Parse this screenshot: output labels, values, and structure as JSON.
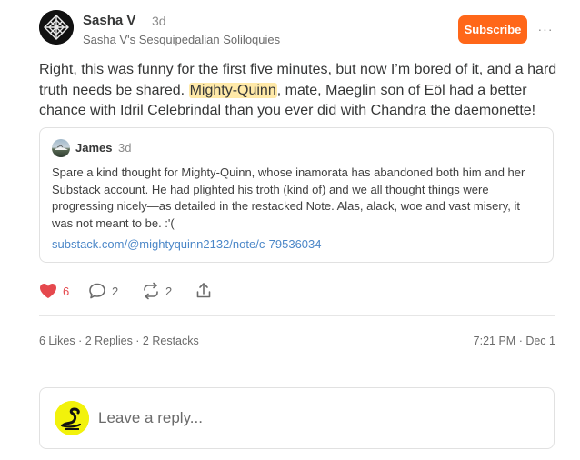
{
  "author": {
    "name": "Sasha V",
    "time": "3d",
    "publication": "Sasha V's Sesquipedalian Soliloquies"
  },
  "header": {
    "subscribe_label": "Subscribe",
    "more_label": "···"
  },
  "note": {
    "text_before": "Right, this was funny for the first five minutes, but now I’m bored of it, and a hard truth needs be shared. ",
    "mention": "Mighty-Quinn",
    "text_after": ", mate, Maeglin son of Eöl had a better chance with Idril Celebrindal than you ever did with Chandra the daemonette!"
  },
  "quote": {
    "author": "James",
    "time": "3d",
    "text": "Spare a kind thought for Mighty-Quinn, whose inamorata has abandoned both him and her Substack account. He had plighted his troth (kind of) and we all thought things were progressing nicely—as detailed in the restacked Note. Alas, alack, woe and vast misery, it was not meant to be. :'(",
    "link": "substack.com/@mightyquinn2132/note/c-79536034"
  },
  "actions": {
    "likes": "6",
    "comments": "2",
    "restacks": "2",
    "like_color": "#e5484d"
  },
  "stats": {
    "summary": "6 Likes · 2 Replies · 2 Restacks",
    "timestamp": "7:21 PM · Dec 1"
  },
  "reply": {
    "placeholder": "Leave a reply..."
  },
  "colors": {
    "accent": "#ff6719",
    "link": "#4b87c8",
    "mention_highlight": "#ffe9a8"
  },
  "icons": [
    "author-avatar",
    "more-icon",
    "quote-author-avatar",
    "heart-icon",
    "comment-icon",
    "restack-icon",
    "share-icon",
    "reply-user-avatar"
  ]
}
